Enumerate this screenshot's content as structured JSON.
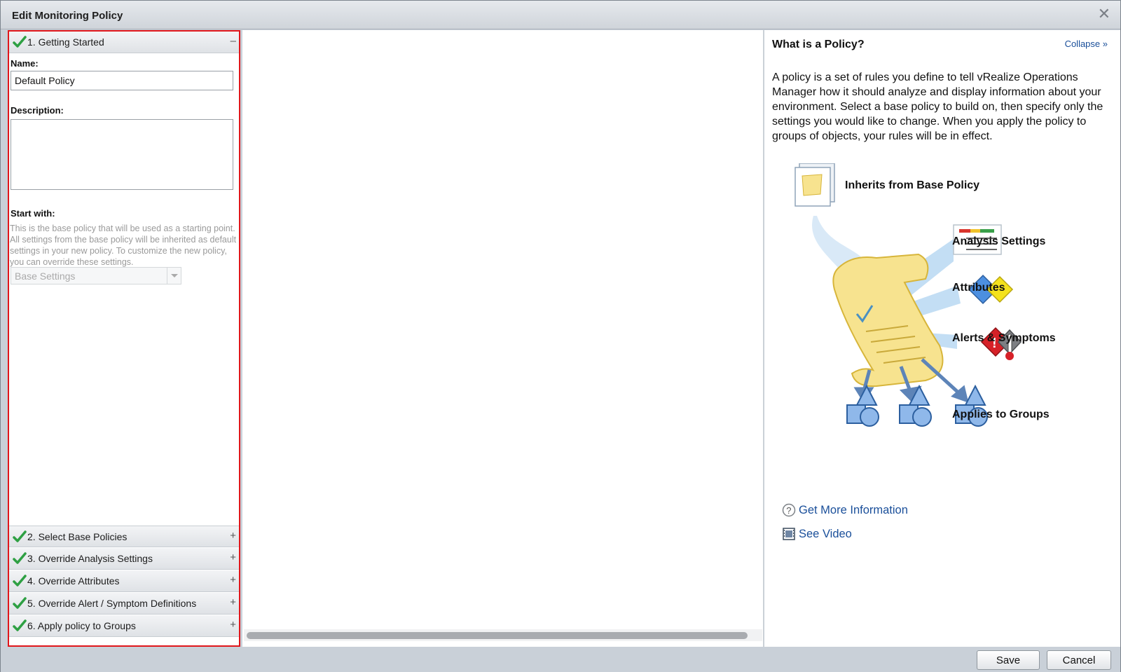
{
  "dialog": {
    "title": "Edit Monitoring Policy",
    "close_glyph": "✕"
  },
  "steps": [
    {
      "label": "1. Getting Started",
      "toggle": "–"
    },
    {
      "label": "2. Select Base Policies",
      "toggle": "+"
    },
    {
      "label": "3. Override Analysis Settings",
      "toggle": "+"
    },
    {
      "label": "4. Override Attributes",
      "toggle": "+"
    },
    {
      "label": "5. Override Alert / Symptom Definitions",
      "toggle": "+"
    },
    {
      "label": "6. Apply policy to Groups",
      "toggle": "+"
    }
  ],
  "form": {
    "name_label": "Name:",
    "name_value": "Default Policy",
    "description_label": "Description:",
    "description_value": "",
    "start_with_label": "Start with:",
    "start_with_help": "This is the base policy that will be used as a starting point. All settings from the base policy will be inherited as default settings in your new policy. To customize the new policy, you can override these settings.",
    "base_select_value": "Base Settings"
  },
  "info": {
    "title": "What is a Policy?",
    "collapse": "Collapse »",
    "intro": "A policy is a set of rules you define to tell vRealize Operations Manager how it should analyze and display information about your environment. Select a base policy to build on, then specify only the settings you would like to change. When you apply the policy to groups of objects, your rules will be in effect.",
    "diagram_labels": {
      "inherits": "Inherits from Base Policy",
      "analysis": "Analysis Settings",
      "attributes": "Attributes",
      "alerts": "Alerts & Symptoms",
      "groups": "Applies to Groups"
    },
    "more_info": "Get More Information",
    "video": "See Video"
  },
  "footer": {
    "save": "Save",
    "cancel": "Cancel"
  },
  "colors": {
    "accent_red": "#e0161b",
    "link_blue": "#1a4f9a",
    "check_green": "#2ea043"
  }
}
